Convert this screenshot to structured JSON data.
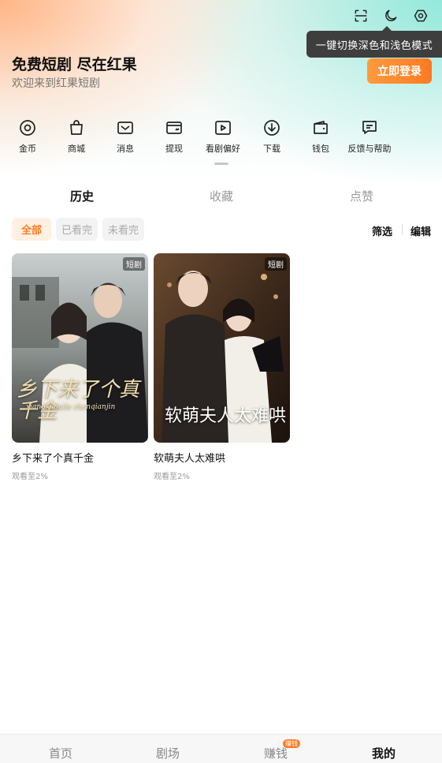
{
  "tooltip": "一键切换深色和浅色模式",
  "hero": {
    "title": "免费短剧 尽在红果",
    "subtitle": "欢迎来到红果短剧",
    "login_label": "立即登录"
  },
  "quick_actions": [
    {
      "label": "金币",
      "icon": "coin-icon"
    },
    {
      "label": "商城",
      "icon": "shopping-bag-icon"
    },
    {
      "label": "消息",
      "icon": "mail-icon"
    },
    {
      "label": "提现",
      "icon": "withdraw-card-icon"
    },
    {
      "label": "看剧偏好",
      "icon": "play-preference-icon"
    },
    {
      "label": "下载",
      "icon": "download-icon"
    },
    {
      "label": "钱包",
      "icon": "wallet-icon"
    },
    {
      "label": "反馈与帮助",
      "icon": "feedback-icon"
    }
  ],
  "tabs": [
    {
      "label": "历史",
      "active": true
    },
    {
      "label": "收藏",
      "active": false
    },
    {
      "label": "点赞",
      "active": false
    }
  ],
  "chips": [
    {
      "label": "全部",
      "active": true
    },
    {
      "label": "已看完",
      "active": false
    },
    {
      "label": "未看完",
      "active": false
    }
  ],
  "actions": {
    "filter": "筛选",
    "edit": "编辑"
  },
  "cards": [
    {
      "title": "乡下来了个真千金",
      "progress": "观看至2%",
      "badge": "短剧",
      "poster_title": "乡下来了个真千金",
      "poster_subtitle": "xiangxialaile zhenqianjin"
    },
    {
      "title": "软萌夫人太难哄",
      "progress": "观看至2%",
      "badge": "短剧",
      "poster_title": "软萌夫人太难哄",
      "poster_subtitle": ""
    }
  ],
  "nav": [
    {
      "label": "首页",
      "active": false
    },
    {
      "label": "剧场",
      "active": false
    },
    {
      "label": "赚钱",
      "active": false,
      "badge": "赚钱"
    },
    {
      "label": "我的",
      "active": true
    }
  ],
  "colors": {
    "accent": "#ff7a22",
    "tooltip_bg": "#3e3e3e"
  }
}
